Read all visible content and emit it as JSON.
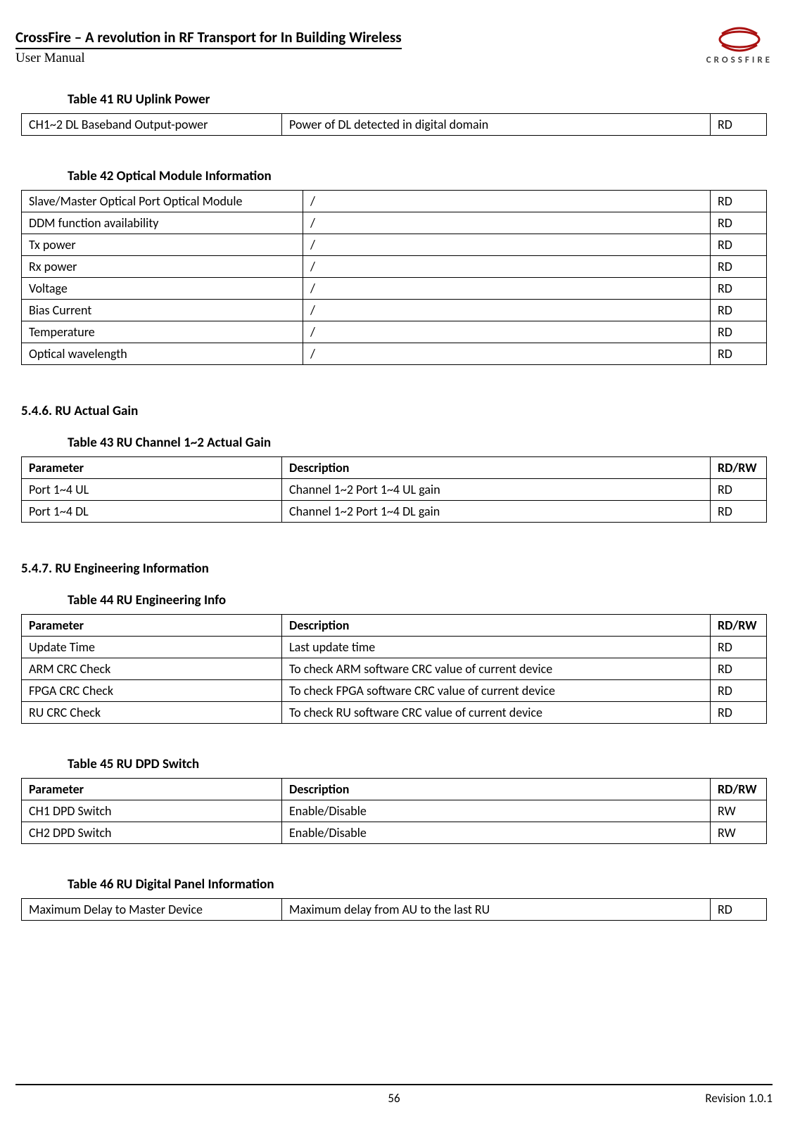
{
  "header": {
    "title": "CrossFire – A revolution in RF Transport for In Building Wireless",
    "subtitle": "User Manual",
    "logo_text": "CROSSFIRE"
  },
  "tables": {
    "t41": {
      "caption": "Table 41     RU Uplink Power",
      "rows": [
        [
          "CH1~2 DL Baseband Output-power",
          "Power of DL detected in digital domain",
          "RD"
        ]
      ]
    },
    "t42": {
      "caption": "Table 42     Optical Module Information",
      "rows": [
        [
          "Slave/Master Optical Port Optical Module",
          "/",
          "RD"
        ],
        [
          "DDM function availability",
          "/",
          "RD"
        ],
        [
          "Tx power",
          "/",
          "RD"
        ],
        [
          "Rx power",
          "/",
          "RD"
        ],
        [
          "Voltage",
          "/",
          "RD"
        ],
        [
          "Bias Current",
          "/",
          "RD"
        ],
        [
          "Temperature",
          "/",
          "RD"
        ],
        [
          "Optical wavelength",
          "/",
          "RD"
        ]
      ]
    },
    "t43": {
      "caption": "Table 43     RU Channel 1~2 Actual Gain",
      "header": [
        "Parameter",
        "Description",
        "RD/RW"
      ],
      "rows": [
        [
          "Port 1~4 UL",
          "Channel 1~2 Port 1~4 UL gain",
          "RD"
        ],
        [
          "Port 1~4 DL",
          "Channel 1~2 Port 1~4 DL gain",
          "RD"
        ]
      ]
    },
    "t44": {
      "caption": "Table 44     RU Engineering Info",
      "header": [
        "Parameter",
        "Description",
        "RD/RW"
      ],
      "rows": [
        [
          "Update Time",
          "Last update time",
          "RD"
        ],
        [
          "ARM CRC Check",
          "To check ARM software CRC value of current device",
          "RD"
        ],
        [
          "FPGA CRC Check",
          "To check FPGA software CRC value of current device",
          "RD"
        ],
        [
          "RU CRC Check",
          "To check RU software CRC value of current device",
          "RD"
        ]
      ]
    },
    "t45": {
      "caption": "Table 45     RU DPD Switch",
      "header": [
        "Parameter",
        "Description",
        "RD/RW"
      ],
      "rows": [
        [
          "CH1 DPD Switch",
          "Enable/Disable",
          "RW"
        ],
        [
          "CH2 DPD Switch",
          "Enable/Disable",
          "RW"
        ]
      ]
    },
    "t46": {
      "caption": "Table 46     RU Digital Panel Information",
      "rows": [
        [
          "Maximum Delay to Master Device",
          "Maximum delay from AU to the last RU",
          "RD"
        ]
      ]
    }
  },
  "sections": {
    "s546": "5.4.6.     RU Actual Gain",
    "s547": "5.4.7.     RU Engineering Information"
  },
  "footer": {
    "page": "56",
    "revision": "Revision 1.0.1"
  }
}
